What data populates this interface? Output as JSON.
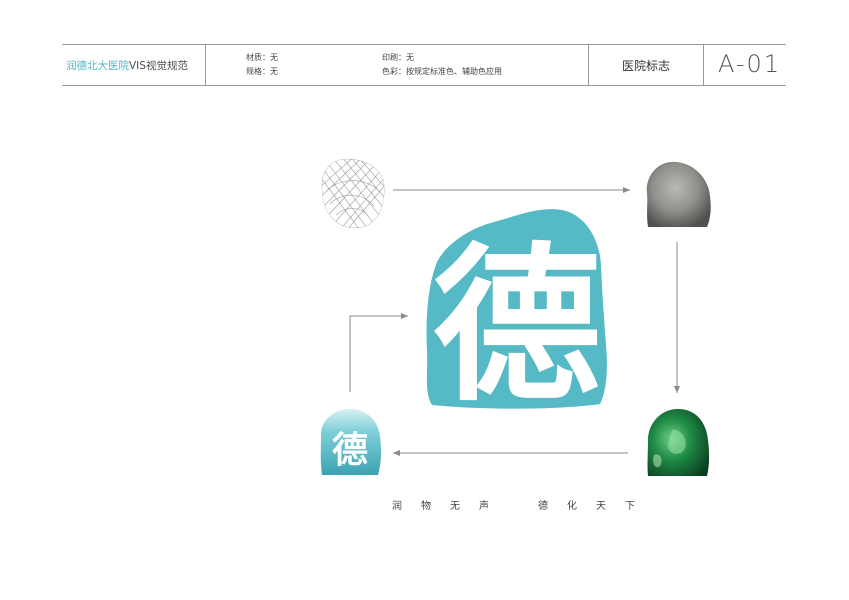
{
  "header": {
    "title_accent": "润德北大医院",
    "title_rest": "VIS视觉规范",
    "material": "材质：无",
    "size": "规格：无",
    "print": "印刷：无",
    "color": "色彩：按规定标准色、辅助色应用",
    "section": "医院标志",
    "code": "A-01"
  },
  "logo": {
    "glyph": "德"
  },
  "slogan": {
    "left": "润物无声",
    "right": "德化天下"
  },
  "colors": {
    "brand": "#55b9c6",
    "line": "#9a9a9a",
    "arrow": "#8a8a8a"
  },
  "icons": [
    "line-stone-icon",
    "grey-stone-icon",
    "jade-stone-icon",
    "glass-logo-icon"
  ]
}
